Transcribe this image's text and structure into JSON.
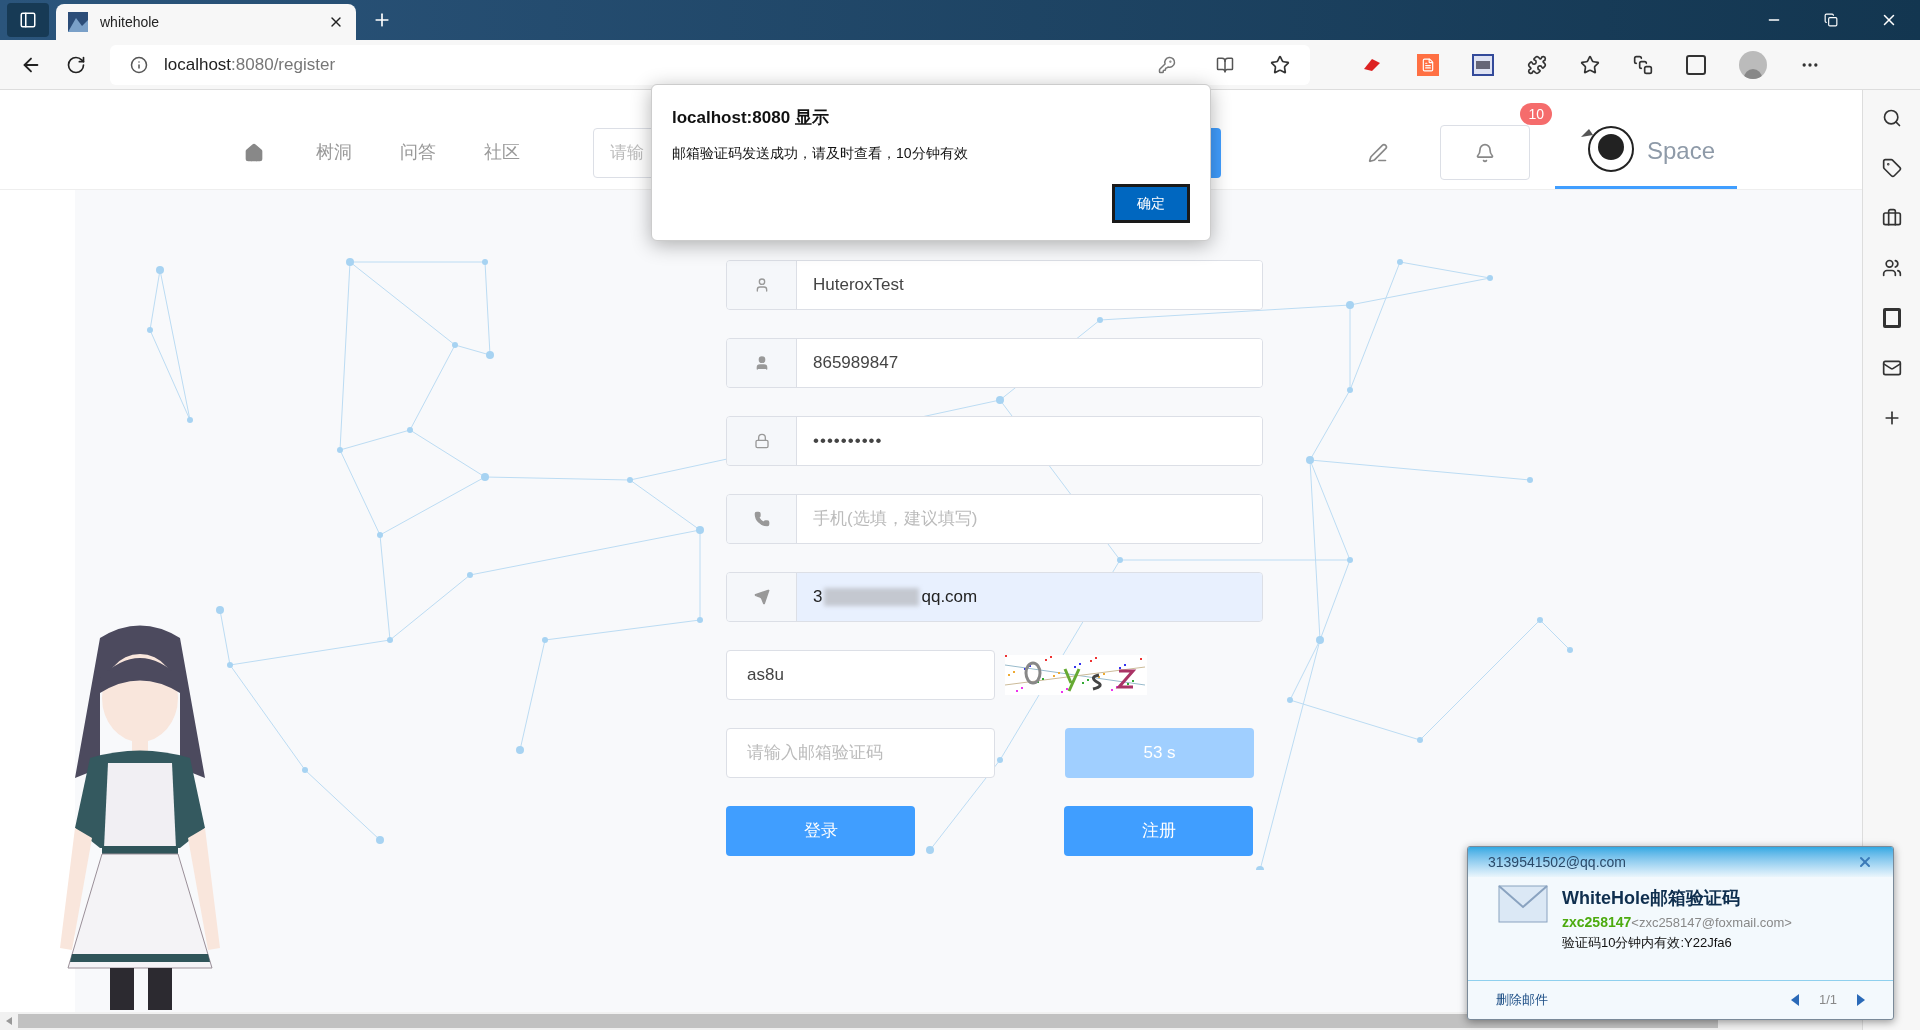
{
  "browser": {
    "tab_title": "whitehole",
    "url_host": "localhost",
    "url_rest": ":8080/register"
  },
  "nav": {
    "items": [
      {
        "label": "树洞"
      },
      {
        "label": "问答"
      },
      {
        "label": "社区"
      }
    ],
    "search_placeholder": "请输",
    "notification_count": "10",
    "space_label": "Space"
  },
  "alert": {
    "title": "localhost:8080 显示",
    "message": "邮箱验证码发送成功，请及时查看，10分钟有效",
    "button": "确定"
  },
  "form": {
    "fields": [
      {
        "kind": "text",
        "value": "HuteroxTest"
      },
      {
        "kind": "text",
        "value": "865989847"
      },
      {
        "kind": "password",
        "value": "••••••••••"
      },
      {
        "kind": "empty",
        "placeholder": "手机(选填，建议填写)"
      },
      {
        "kind": "redacted",
        "value_start": "3",
        "value_end": "qq.com"
      }
    ],
    "captcha": {
      "value": "as8u"
    },
    "email_code": {
      "placeholder": "请输入邮箱验证码"
    },
    "countdown": {
      "label": "53 s",
      "disabled": true
    },
    "buttons": [
      {
        "label": "登录"
      },
      {
        "label": "注册"
      }
    ]
  },
  "mail_popup": {
    "account": "3139541502@qq.com",
    "subject": "WhiteHole邮箱验证码",
    "sender_name": "zxc258147",
    "sender_address": "<zxc258147@foxmail.com>",
    "body": "验证码10分钟内有效:Y22Jfa6",
    "delete_label": "删除邮件",
    "page": "1/1"
  }
}
